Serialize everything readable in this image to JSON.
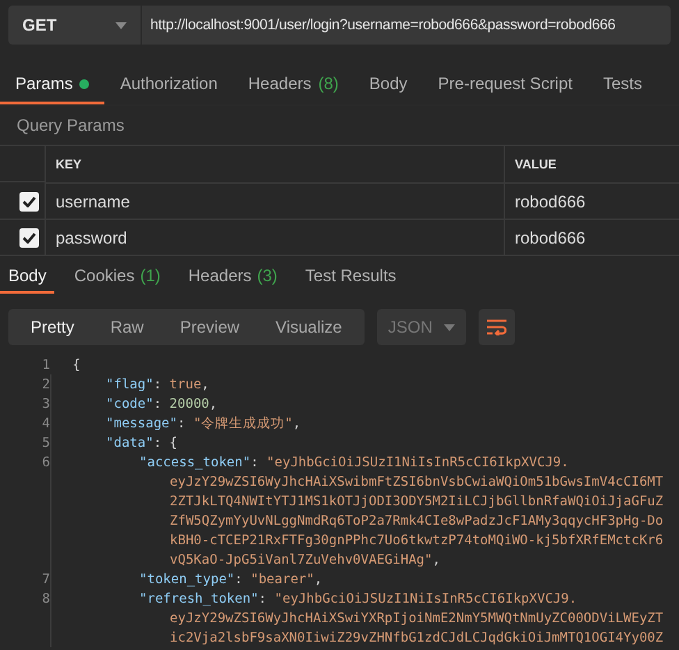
{
  "request": {
    "method": "GET",
    "url": "http://localhost:9001/user/login?username=robod666&password=robod666"
  },
  "request_tabs": [
    {
      "label": "Params",
      "dot": true,
      "selected": true
    },
    {
      "label": "Authorization",
      "dot": false,
      "selected": false
    },
    {
      "label": "Headers",
      "count": "(8)",
      "dot": false,
      "selected": false
    },
    {
      "label": "Body",
      "dot": false,
      "selected": false
    },
    {
      "label": "Pre-request Script",
      "dot": false,
      "selected": false
    },
    {
      "label": "Tests",
      "dot": false,
      "selected": false
    }
  ],
  "query_params": {
    "title": "Query Params",
    "columns": [
      "KEY",
      "VALUE"
    ],
    "rows": [
      {
        "checked": true,
        "key": "username",
        "value": "robod666"
      },
      {
        "checked": true,
        "key": "password",
        "value": "robod666"
      }
    ]
  },
  "response_tabs": [
    {
      "label": "Body",
      "selected": true
    },
    {
      "label": "Cookies",
      "count": "(1)",
      "selected": false
    },
    {
      "label": "Headers",
      "count": "(3)",
      "selected": false
    },
    {
      "label": "Test Results",
      "selected": false
    }
  ],
  "view_modes": [
    {
      "label": "Pretty",
      "selected": true
    },
    {
      "label": "Raw",
      "selected": false
    },
    {
      "label": "Preview",
      "selected": false
    },
    {
      "label": "Visualize",
      "selected": false
    }
  ],
  "format": "JSON",
  "wrap_lines": {
    "on": true
  },
  "code": [
    {
      "number": "1",
      "tokens": [
        {
          "kind": "punct",
          "text": "{"
        }
      ],
      "children": [
        {
          "number": "2",
          "tokens": [
            {
              "kind": "key",
              "text": "\"flag\""
            },
            {
              "kind": "punct",
              "text": ": "
            },
            {
              "kind": "bool",
              "text": "true"
            },
            {
              "kind": "punct",
              "text": ","
            }
          ]
        },
        {
          "number": "3",
          "tokens": [
            {
              "kind": "key",
              "text": "\"code\""
            },
            {
              "kind": "punct",
              "text": ": "
            },
            {
              "kind": "num",
              "text": "20000"
            },
            {
              "kind": "punct",
              "text": ","
            }
          ]
        },
        {
          "number": "4",
          "tokens": [
            {
              "kind": "key",
              "text": "\"message\""
            },
            {
              "kind": "punct",
              "text": ": "
            },
            {
              "kind": "str",
              "text": "\"令牌生成成功\""
            },
            {
              "kind": "punct",
              "text": ","
            }
          ]
        },
        {
          "number": "5",
          "tokens": [
            {
              "kind": "key",
              "text": "\"data\""
            },
            {
              "kind": "punct",
              "text": ": {"
            }
          ],
          "children": [
            {
              "number": "6",
              "tokens": [
                {
                  "kind": "key",
                  "text": "\"access_token\""
                },
                {
                  "kind": "punct",
                  "text": ": "
                },
                {
                  "kind": "str",
                  "text": "\"eyJhbGciOiJSUzI1NiIsInR5cCI6IkpXVCJ9."
                }
              ],
              "children": [
                {
                  "tokens": [
                    {
                      "kind": "str",
                      "text": "eyJzY29wZSI6WyJhcHAiXSwibmFtZSI6bnVsbCwiaWQiOm51bGwsImV4cCI6MT"
                    }
                  ]
                },
                {
                  "tokens": [
                    {
                      "kind": "str",
                      "text": "2ZTJkLTQ4NWItYTJ1MS1kOTJjODI3ODY5M2IiLCJjbGllbnRfaWQiOiJjaGFuZ"
                    }
                  ]
                },
                {
                  "tokens": [
                    {
                      "kind": "str",
                      "text": "ZfW5QZymYyUvNLggNmdRq6ToP2a7Rmk4CIe8wPadzJcF1AMy3qqycHF3pHg-Do"
                    }
                  ]
                },
                {
                  "tokens": [
                    {
                      "kind": "str",
                      "text": "kBH0-cTCEP21RxFTFg30gnPPhc7Uo6tkwtzP74toMQiWO-kj5bfXRfEMctcKr6"
                    }
                  ]
                },
                {
                  "tokens": [
                    {
                      "kind": "str",
                      "text": "vQ5KaO-JpG5iVanl7ZuVehv0VAEGiHAg\""
                    },
                    {
                      "kind": "punct",
                      "text": ","
                    }
                  ]
                }
              ]
            },
            {
              "number": "7",
              "tokens": [
                {
                  "kind": "key",
                  "text": "\"token_type\""
                },
                {
                  "kind": "punct",
                  "text": ": "
                },
                {
                  "kind": "str",
                  "text": "\"bearer\""
                },
                {
                  "kind": "punct",
                  "text": ","
                }
              ]
            },
            {
              "number": "8",
              "tokens": [
                {
                  "kind": "key",
                  "text": "\"refresh_token\""
                },
                {
                  "kind": "punct",
                  "text": ": "
                },
                {
                  "kind": "str",
                  "text": "\"eyJhbGciOiJSUzI1NiIsInR5cCI6IkpXVCJ9."
                }
              ],
              "children": [
                {
                  "tokens": [
                    {
                      "kind": "str",
                      "text": "eyJzY29wZSI6WyJhcHAiXSwiYXRpIjoiNmE2NmY5MWQtNmUyZC00ODViLWEyZT"
                    }
                  ]
                },
                {
                  "tokens": [
                    {
                      "kind": "str",
                      "text": "ic2Vja2lsbF9saXN0IiwiZ29vZHNfbG1zdCJdLCJqdGkiOiJmMTQ1OGI4Yy00Z"
                    }
                  ]
                }
              ]
            }
          ]
        }
      ]
    }
  ]
}
